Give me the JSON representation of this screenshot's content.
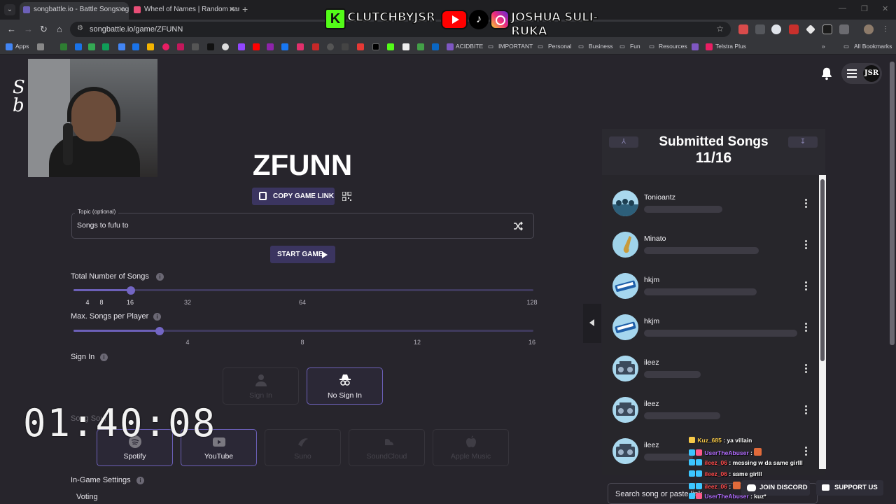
{
  "browser": {
    "tabs": [
      {
        "title": "songbattle.io - Battle Songs ag",
        "active": true,
        "favicon_color": "#6c60b8"
      },
      {
        "title": "Wheel of Names | Random nam",
        "active": false,
        "favicon_color": "#e94e77"
      }
    ],
    "url": "songbattle.io/game/ZFUNN",
    "bookmarks": [
      {
        "label": "Apps"
      },
      {
        "label": "ACIDBITE"
      },
      {
        "label": "IMPORTANT"
      },
      {
        "label": "Personal"
      },
      {
        "label": "Business"
      },
      {
        "label": "Fun"
      },
      {
        "label": "Resources"
      },
      {
        "label": "Telstra Plus"
      }
    ],
    "all_bookmarks": "All Bookmarks"
  },
  "overlay": {
    "kick_handle": "CLUTCHBYJSR",
    "socials_handle": "JOSHUA SULI-RUKA"
  },
  "header": {
    "avatar_text": "JSR"
  },
  "game": {
    "code": "ZFUNN",
    "copy_link_label": "COPY GAME LINK",
    "topic_label": "Topic (optional)",
    "topic_value": "Songs to fufu to",
    "start_label": "START GAME",
    "total_songs_label": "Total Number of Songs",
    "total_songs_value": 16,
    "total_songs_ticks": [
      "4",
      "8",
      "16",
      "32",
      "64",
      "128"
    ],
    "max_per_player_label": "Max. Songs per Player",
    "max_per_player_value": 3,
    "max_per_player_ticks": [
      "4",
      "8",
      "12",
      "16"
    ],
    "sign_in_label": "Sign In",
    "sign_in_options": [
      {
        "label": "Sign In",
        "selected": false
      },
      {
        "label": "No Sign In",
        "selected": true
      }
    ],
    "song_source_label": "Song Sour",
    "song_sources": [
      {
        "label": "Spotify",
        "selected": true
      },
      {
        "label": "YouTube",
        "selected": true
      },
      {
        "label": "Suno",
        "selected": false
      },
      {
        "label": "SoundCloud",
        "selected": false
      },
      {
        "label": "Apple Music",
        "selected": false
      }
    ],
    "in_game_settings_label": "In-Game Settings",
    "voting_label": "Voting"
  },
  "timer": "01:40:08",
  "songs_panel": {
    "title": "Submitted Songs",
    "count": "11/16",
    "entries": [
      {
        "name": "Tonioantz",
        "avatar": "crowd"
      },
      {
        "name": "Minato",
        "avatar": "saxophone"
      },
      {
        "name": "hkjm",
        "avatar": "keyboard"
      },
      {
        "name": "hkjm",
        "avatar": "keyboard"
      },
      {
        "name": "ileez",
        "avatar": "boombox"
      },
      {
        "name": "ileez",
        "avatar": "boombox"
      },
      {
        "name": "ileez",
        "avatar": "boombox"
      }
    ],
    "search_placeholder": "Search song or paste link"
  },
  "footer_buttons": {
    "discord": "JOIN DISCORD",
    "support": "SUPPORT US"
  },
  "chat": [
    {
      "user": "Kuz_685",
      "user_color": "#f7c948",
      "message": ": ya villain"
    },
    {
      "user": "UserTheAbuser",
      "user_color": "#b36cff",
      "message": ":"
    },
    {
      "user": "ileez_06",
      "user_color": "#ff4b4b",
      "message": ": messing w da same girlll"
    },
    {
      "user": "ileez_06",
      "user_color": "#ff4b4b",
      "message": ": same girlll"
    },
    {
      "user": "ileez_06",
      "user_color": "#ff4b4b",
      "message": ":"
    },
    {
      "user": "UserTheAbuser",
      "user_color": "#b36cff",
      "message": ": kuz*"
    }
  ]
}
